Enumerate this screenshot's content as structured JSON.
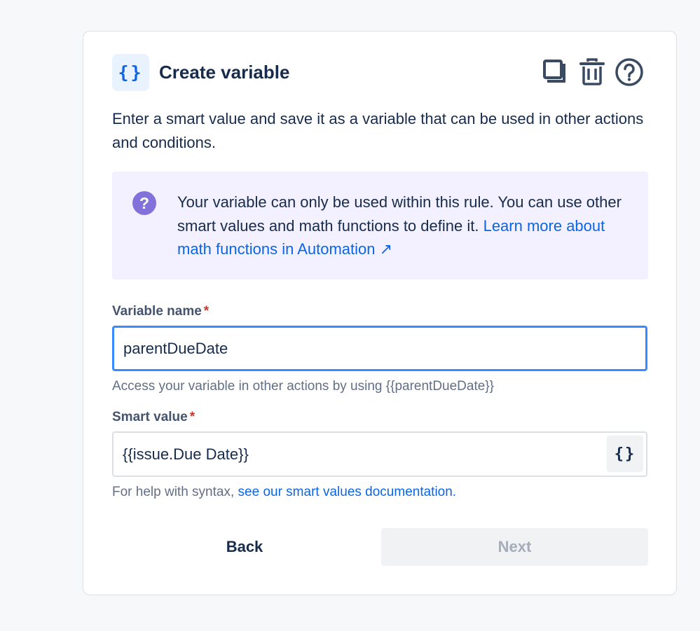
{
  "header": {
    "icon": "curly-braces-icon",
    "icon_glyph": "{}",
    "title": "Create variable",
    "actions": [
      "copy-icon",
      "trash-icon",
      "help-icon"
    ]
  },
  "description": "Enter a smart value and save it as a variable that can be used in other actions and conditions.",
  "info": {
    "icon": "question-circle-icon",
    "text": "Your variable can only be used within this rule. You can use other smart values and math functions to define it.",
    "link_text": "Learn more about math functions in Automation",
    "link_arrow": "↗"
  },
  "variable_name": {
    "label": "Variable name",
    "required_mark": "*",
    "value": "parentDueDate",
    "helper": "Access your variable in other actions by using {{parentDueDate}}"
  },
  "smart_value": {
    "label": "Smart value",
    "required_mark": "*",
    "value": "{{issue.Due Date}}",
    "button_glyph": "{}",
    "helper_prefix": "For help with syntax, ",
    "helper_link": "see our smart values documentation."
  },
  "buttons": {
    "back": "Back",
    "next": "Next"
  },
  "colors": {
    "accent": "#0c66e4",
    "focus_border": "#388bff",
    "info_bg": "#f3f0ff",
    "info_icon": "#8270db",
    "required": "#c9372c",
    "disabled_text": "#a5adba"
  }
}
